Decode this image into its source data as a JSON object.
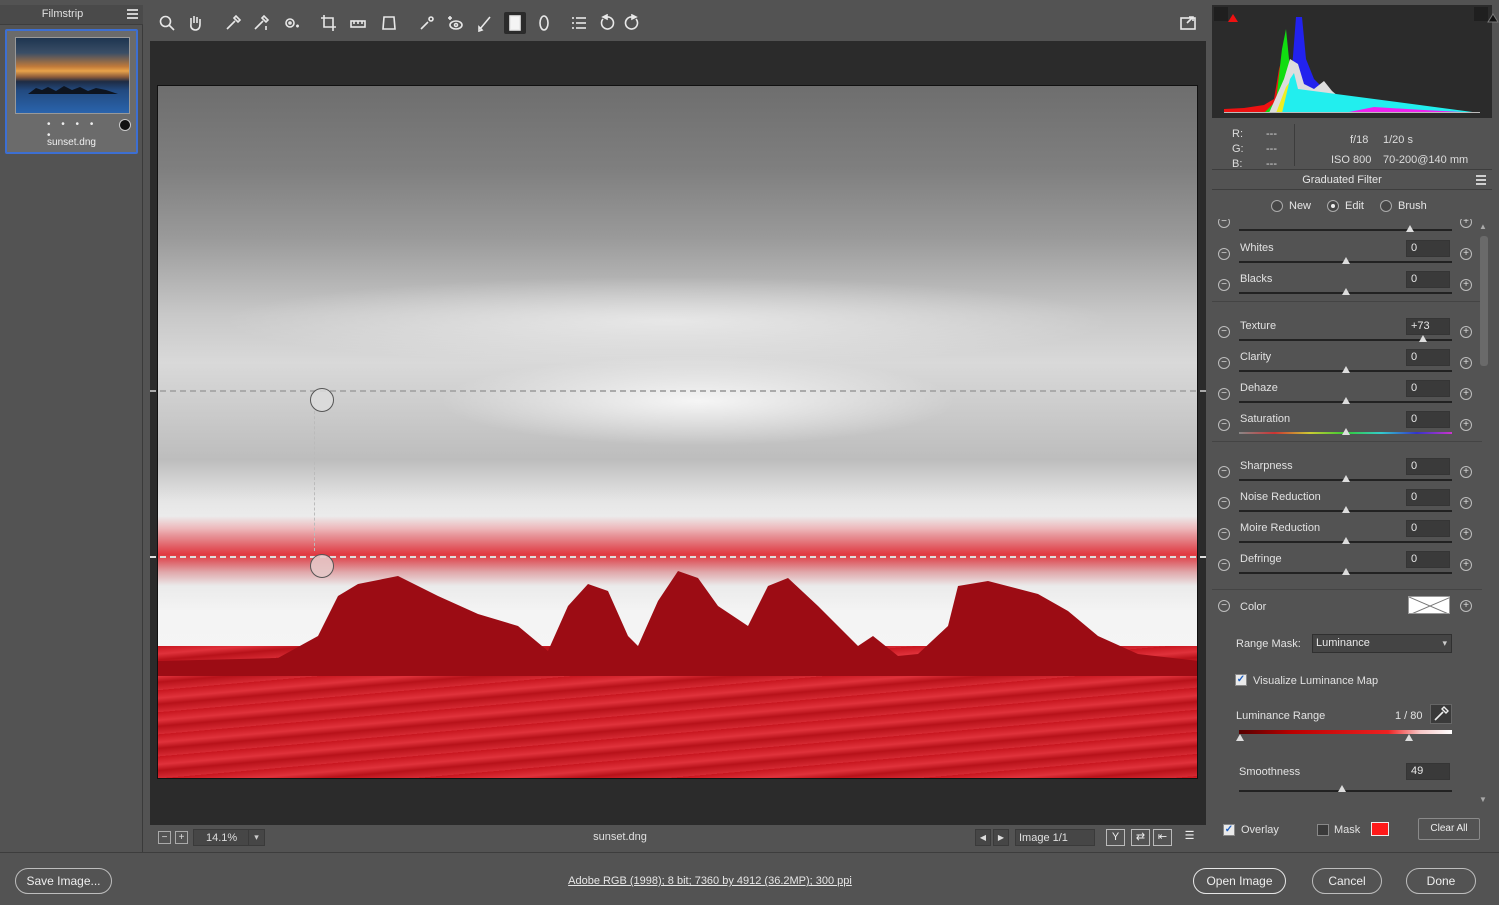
{
  "filmstrip": {
    "title": "Filmstrip",
    "thumb_name": "sunset.dng",
    "thumb_dots": "• • • • •"
  },
  "toolbar": {
    "tools": [
      "zoom-icon",
      "hand-icon",
      "white-balance-icon",
      "color-sampler-icon",
      "targeted-adjustment-icon",
      "crop-icon",
      "straighten-icon",
      "transform-icon",
      "spot-removal-icon",
      "red-eye-icon",
      "adjustment-brush-icon",
      "graduated-filter-icon",
      "radial-filter-icon",
      "preferences-icon",
      "rotate-left-icon",
      "rotate-right-icon"
    ],
    "active_tool": "graduated-filter-icon"
  },
  "preview": {
    "zoom": "14.1%",
    "filename": "sunset.dng",
    "image_counter": "Image 1/1",
    "view_y": "Y"
  },
  "info": {
    "r_label": "R:",
    "g_label": "G:",
    "b_label": "B:",
    "r_val": "---",
    "g_val": "---",
    "b_val": "---",
    "aperture": "f/18",
    "shutter": "1/20 s",
    "iso": "ISO 800",
    "lens": "70-200@140 mm"
  },
  "panel": {
    "title": "Graduated Filter",
    "modes": [
      {
        "label": "New",
        "checked": false
      },
      {
        "label": "Edit",
        "checked": true
      },
      {
        "label": "Brush",
        "checked": false
      }
    ]
  },
  "sliders": [
    {
      "label": "Whites",
      "value": "0",
      "pos": 0.5
    },
    {
      "label": "Blacks",
      "value": "0",
      "pos": 0.5
    },
    {
      "label": "Texture",
      "value": "+73",
      "pos": 0.865
    },
    {
      "label": "Clarity",
      "value": "0",
      "pos": 0.5
    },
    {
      "label": "Dehaze",
      "value": "0",
      "pos": 0.5
    },
    {
      "label": "Saturation",
      "value": "0",
      "pos": 0.5
    },
    {
      "label": "Sharpness",
      "value": "0",
      "pos": 0.5
    },
    {
      "label": "Noise Reduction",
      "value": "0",
      "pos": 0.5
    },
    {
      "label": "Moire Reduction",
      "value": "0",
      "pos": 0.5
    },
    {
      "label": "Defringe",
      "value": "0",
      "pos": 0.5
    }
  ],
  "color": {
    "label": "Color",
    "range_mask_label": "Range Mask:",
    "range_mask_value": "Luminance",
    "visualize_label": "Visualize Luminance Map",
    "lum_range_label": "Luminance Range",
    "lum_range_value": "1 / 80",
    "smoothness_label": "Smoothness",
    "smoothness_value": "49"
  },
  "bottom": {
    "overlay_label": "Overlay",
    "mask_label": "Mask",
    "clear_all": "Clear All",
    "mask_color": "#ff1a1a"
  },
  "footer": {
    "save_image": "Save Image...",
    "info": "Adobe RGB (1998); 8 bit; 7360 by 4912 (36.2MP); 300 ppi",
    "open_image": "Open Image",
    "cancel": "Cancel",
    "done": "Done"
  }
}
